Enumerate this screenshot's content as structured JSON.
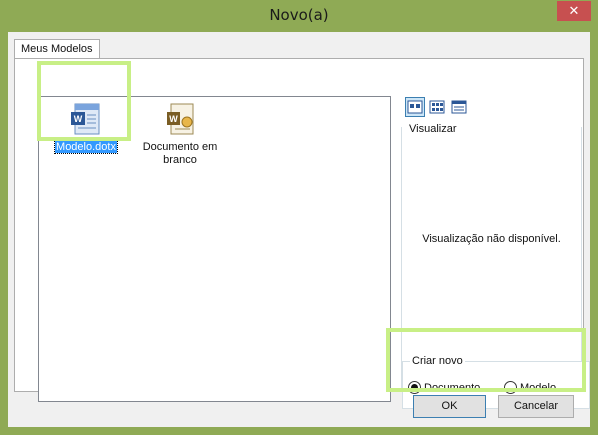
{
  "window": {
    "title": "Novo(a)",
    "close_glyph": "✕"
  },
  "tabs": [
    {
      "label": "Meus Modelos"
    }
  ],
  "templates": [
    {
      "label": "Modelo.dotx",
      "icon": "word-template-icon",
      "selected": true
    },
    {
      "label": "Documento em branco",
      "icon": "word-blank-document-icon",
      "selected": false
    }
  ],
  "view_buttons": [
    {
      "icon": "large-icons-view-icon",
      "active": true
    },
    {
      "icon": "list-view-icon",
      "active": false
    },
    {
      "icon": "details-view-icon",
      "active": false
    }
  ],
  "preview": {
    "label": "Visualizar",
    "message": "Visualização não disponível."
  },
  "create_new": {
    "label": "Criar novo",
    "options": [
      {
        "label": "Documento",
        "checked": true
      },
      {
        "label": "Modelo",
        "checked": false
      }
    ]
  },
  "buttons": {
    "ok": "OK",
    "cancel": "Cancelar"
  },
  "colors": {
    "highlight": "#c8ef86",
    "selection": "#3399ff",
    "frame": "#8faa55"
  }
}
